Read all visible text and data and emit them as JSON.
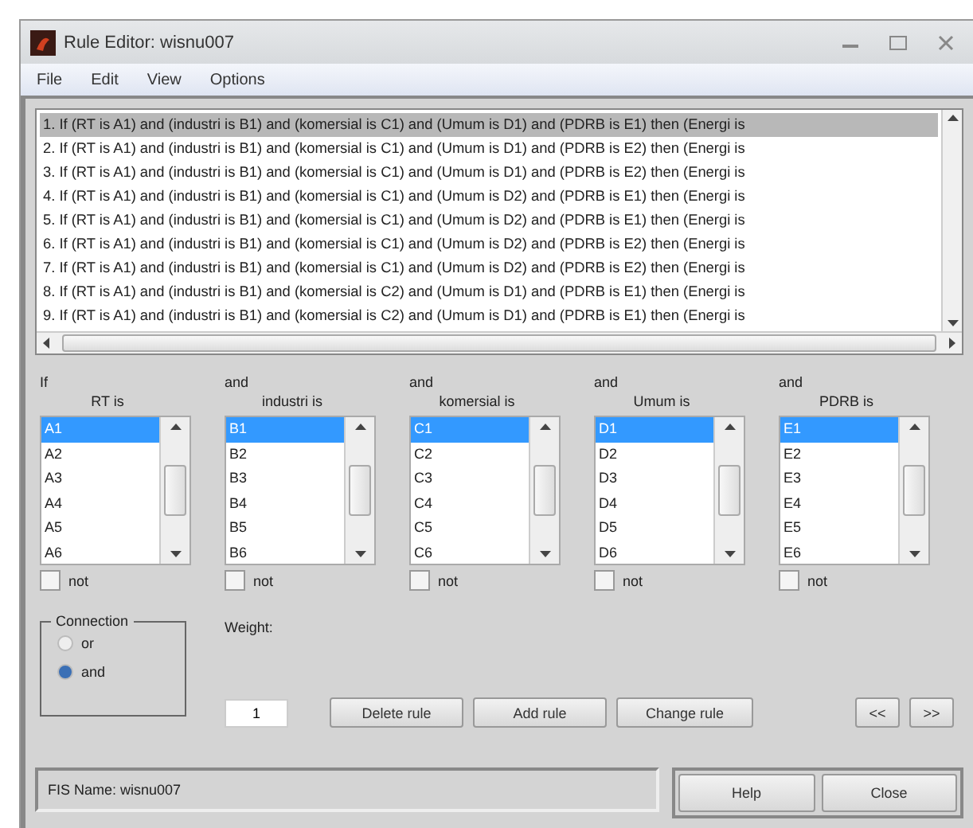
{
  "window": {
    "title": "Rule Editor: wisnu007"
  },
  "menu": [
    "File",
    "Edit",
    "View",
    "Options"
  ],
  "rules": [
    {
      "text": "1. If (RT is A1) and (industri is B1) and (komersial is C1) and (Umum is D1) and (PDRB is E1) then (Energi is",
      "selected": true
    },
    {
      "text": "2. If (RT is A1) and (industri is B1) and (komersial is C1) and (Umum is D1) and (PDRB is E2) then (Energi is",
      "selected": false
    },
    {
      "text": "3. If (RT is A1) and (industri is B1) and (komersial is C1) and (Umum is D1) and (PDRB is E2) then (Energi is",
      "selected": false
    },
    {
      "text": "4. If (RT is A1) and (industri is B1) and (komersial is C1) and (Umum is D2) and (PDRB is E1) then (Energi is",
      "selected": false
    },
    {
      "text": "5. If (RT is A1) and (industri is B1) and (komersial is C1) and (Umum is D2) and (PDRB is E1) then (Energi is",
      "selected": false
    },
    {
      "text": "6. If (RT is A1) and (industri is B1) and (komersial is C1) and (Umum is D2) and (PDRB is E2) then (Energi is",
      "selected": false
    },
    {
      "text": "7. If (RT is A1) and (industri is B1) and (komersial is C1) and (Umum is D2) and (PDRB is E2) then (Energi is",
      "selected": false
    },
    {
      "text": "8. If (RT is A1) and (industri is B1) and (komersial is C2) and (Umum is D1) and (PDRB is E1) then (Energi is",
      "selected": false
    },
    {
      "text": "9. If (RT is A1) and (industri is B1) and (komersial is C2) and (Umum is D1) and (PDRB is E1) then (Energi is",
      "selected": false
    }
  ],
  "inputs": [
    {
      "connector": "If",
      "label": "RT is",
      "not_label": "not",
      "not_checked": false,
      "items": [
        {
          "text": "A1",
          "selected": true
        },
        {
          "text": "A2",
          "selected": false
        },
        {
          "text": "A3",
          "selected": false
        },
        {
          "text": "A4",
          "selected": false
        },
        {
          "text": "A5",
          "selected": false
        },
        {
          "text": "A6",
          "selected": false
        }
      ]
    },
    {
      "connector": "and",
      "label": "industri is",
      "not_label": "not",
      "not_checked": false,
      "items": [
        {
          "text": "B1",
          "selected": true
        },
        {
          "text": "B2",
          "selected": false
        },
        {
          "text": "B3",
          "selected": false
        },
        {
          "text": "B4",
          "selected": false
        },
        {
          "text": "B5",
          "selected": false
        },
        {
          "text": "B6",
          "selected": false
        }
      ]
    },
    {
      "connector": "and",
      "label": "komersial is",
      "not_label": "not",
      "not_checked": false,
      "items": [
        {
          "text": "C1",
          "selected": true
        },
        {
          "text": "C2",
          "selected": false
        },
        {
          "text": "C3",
          "selected": false
        },
        {
          "text": "C4",
          "selected": false
        },
        {
          "text": "C5",
          "selected": false
        },
        {
          "text": "C6",
          "selected": false
        }
      ]
    },
    {
      "connector": "and",
      "label": "Umum is",
      "not_label": "not",
      "not_checked": false,
      "items": [
        {
          "text": "D1",
          "selected": true
        },
        {
          "text": "D2",
          "selected": false
        },
        {
          "text": "D3",
          "selected": false
        },
        {
          "text": "D4",
          "selected": false
        },
        {
          "text": "D5",
          "selected": false
        },
        {
          "text": "D6",
          "selected": false
        }
      ]
    },
    {
      "connector": "and",
      "label": "PDRB is",
      "not_label": "not",
      "not_checked": false,
      "items": [
        {
          "text": "E1",
          "selected": true
        },
        {
          "text": "E2",
          "selected": false
        },
        {
          "text": "E3",
          "selected": false
        },
        {
          "text": "E4",
          "selected": false
        },
        {
          "text": "E5",
          "selected": false
        },
        {
          "text": "E6",
          "selected": false
        }
      ]
    }
  ],
  "connection": {
    "title": "Connection",
    "options": [
      {
        "label": "or",
        "selected": false
      },
      {
        "label": "and",
        "selected": true
      }
    ]
  },
  "weight": {
    "label": "Weight:",
    "value": "1"
  },
  "buttons": [
    "Delete rule",
    "Add rule",
    "Change rule"
  ],
  "nav_buttons": [
    "<<",
    ">>"
  ],
  "status": "FIS Name: wisnu007",
  "footer_buttons": [
    "Help",
    "Close"
  ]
}
